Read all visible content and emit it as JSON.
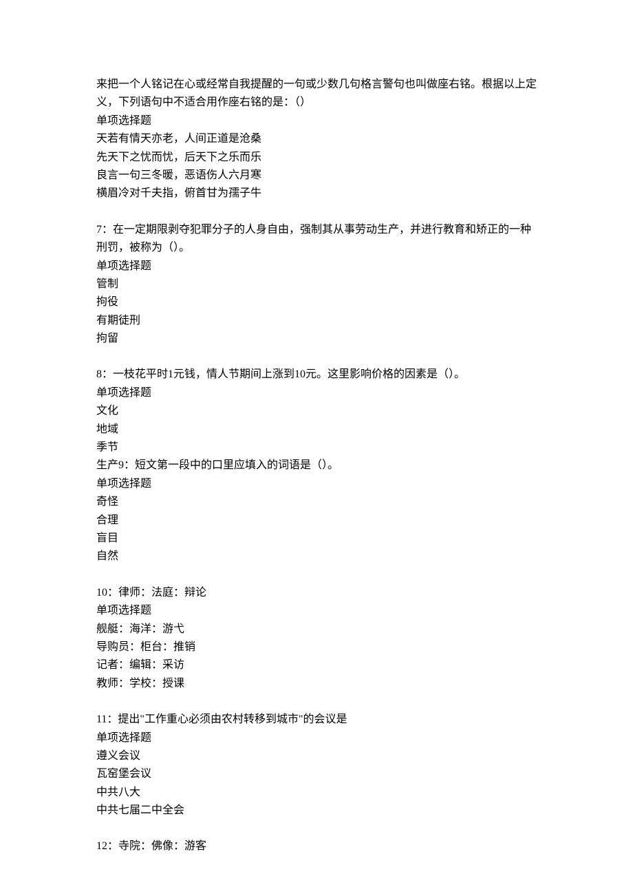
{
  "q6_continuation": {
    "text_line1": "来把一个人铭记在心或经常自我提醒的一句或少数几句格言警句也叫做座右铭。根据以上定义，下列语句中不适合用作座右铭的是：（）",
    "type": "单项选择题",
    "options": [
      "天若有情天亦老，人间正道是沧桑",
      "先天下之忧而忧，后天下之乐而乐",
      "良言一句三冬暖，恶语伤人六月寒",
      "横眉冷对千夫指，俯首甘为孺子牛"
    ]
  },
  "q7": {
    "text": "7：在一定期限剥夺犯罪分子的人身自由，强制其从事劳动生产，并进行教育和矫正的一种刑罚，被称为（）。",
    "type": "单项选择题",
    "options": [
      "管制",
      "拘役",
      "有期徒刑",
      "拘留"
    ]
  },
  "q8": {
    "text": "8：一枝花平时1元钱，情人节期间上涨到10元。这里影响价格的因素是（）。",
    "type": "单项选择题",
    "options": [
      "文化",
      "地域",
      "季节"
    ],
    "last_option_prefix": "生产"
  },
  "q9": {
    "text": "9：短文第一段中的口里应填入的词语是（）。",
    "type": "单项选择题",
    "options": [
      "奇怪",
      "合理",
      "盲目",
      "自然"
    ]
  },
  "q10": {
    "text": "10：律师：法庭：辩论",
    "type": "单项选择题",
    "options": [
      "舰艇：海洋：游弋",
      "导购员：柜台：推销",
      "记者：编辑：采访",
      "教师：学校：授课"
    ]
  },
  "q11": {
    "text": "11：提出\"工作重心必须由农村转移到城市\"的会议是",
    "type": "单项选择题",
    "options": [
      "遵义会议",
      "瓦窑堡会议",
      "中共八大",
      "中共七届二中全会"
    ]
  },
  "q12": {
    "text": "12：寺院：佛像：游客"
  }
}
